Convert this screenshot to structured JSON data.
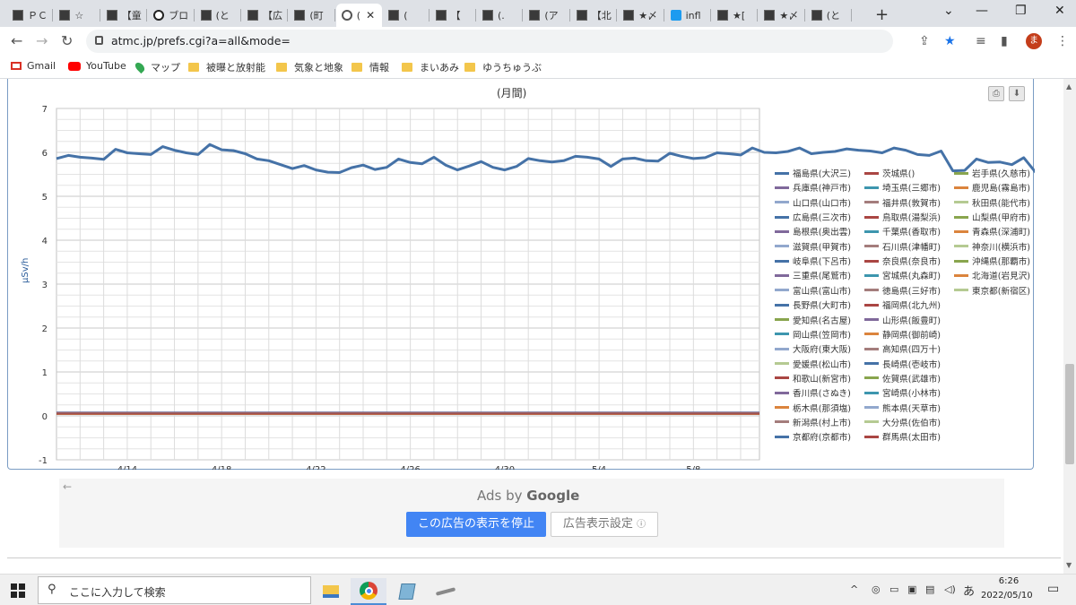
{
  "tabs": [
    {
      "label": "ＰＣ",
      "icon": "site-favicon-icon"
    },
    {
      "label": "☆",
      "icon": "site-favicon-icon"
    },
    {
      "label": "【童",
      "icon": "site-favicon-icon"
    },
    {
      "label": "ブロ",
      "icon": "info-circle-icon"
    },
    {
      "label": "(と",
      "icon": "site-favicon-icon"
    },
    {
      "label": "【広",
      "icon": "site-favicon-icon"
    },
    {
      "label": "(町",
      "icon": "site-favicon-icon"
    },
    {
      "label": "(",
      "icon": "globe-icon",
      "active": true
    },
    {
      "label": "(",
      "icon": "site-favicon-icon"
    },
    {
      "label": "【",
      "icon": "site-favicon-icon"
    },
    {
      "label": "(.",
      "icon": "site-favicon-icon"
    },
    {
      "label": "(ア",
      "icon": "site-favicon-icon"
    },
    {
      "label": "【北",
      "icon": "site-favicon-icon"
    },
    {
      "label": "★〆",
      "icon": "site-favicon-icon"
    },
    {
      "label": "infl",
      "icon": "twitter-icon"
    },
    {
      "label": "★[",
      "icon": "site-favicon-icon"
    },
    {
      "label": "★〆",
      "icon": "site-favicon-icon"
    },
    {
      "label": "(と",
      "icon": "site-favicon-icon"
    }
  ],
  "toolbar": {
    "url": "atmc.jp/prefs.cgi?a=all&mode=",
    "avatar": "ま"
  },
  "bookmarks": [
    {
      "label": "Gmail",
      "icon": "gmail-icon"
    },
    {
      "label": "YouTube",
      "icon": "youtube-icon"
    },
    {
      "label": "マップ",
      "icon": "maps-icon"
    },
    {
      "label": "被曝と放射能",
      "icon": "folder-icon"
    },
    {
      "label": "気象と地象",
      "icon": "folder-icon"
    },
    {
      "label": "情報",
      "icon": "folder-icon"
    },
    {
      "label": "まいあみ",
      "icon": "folder-icon"
    },
    {
      "label": "ゆうちゅうぶ",
      "icon": "folder-icon"
    }
  ],
  "chart_data": {
    "type": "line",
    "title": "(月間)",
    "ylabel": "μSv/h",
    "ylim": [
      -1,
      7
    ],
    "yticks": [
      "7",
      "6",
      "5",
      "4",
      "3",
      "2",
      "1",
      "0",
      "-1"
    ],
    "xticks": [
      "4/14",
      "4/18",
      "4/22",
      "4/26",
      "4/30",
      "5/4",
      "5/8"
    ],
    "x_label_positions_days": [
      3,
      7,
      11,
      15,
      19,
      23,
      27
    ],
    "x_range_days": [
      0,
      29.8
    ],
    "grid": true,
    "legend_position": "right",
    "series": [
      {
        "name": "福島県(大沢三)",
        "color": "#4572a7",
        "x_step_days": 0.5,
        "values": [
          5.86,
          5.93,
          5.89,
          5.87,
          5.84,
          6.07,
          5.99,
          5.97,
          5.95,
          6.13,
          6.05,
          5.99,
          5.95,
          6.18,
          6.06,
          6.04,
          5.97,
          5.85,
          5.81,
          5.72,
          5.63,
          5.7,
          5.6,
          5.55,
          5.54,
          5.65,
          5.71,
          5.61,
          5.66,
          5.85,
          5.77,
          5.74,
          5.89,
          5.71,
          5.6,
          5.69,
          5.79,
          5.66,
          5.6,
          5.68,
          5.86,
          5.81,
          5.78,
          5.81,
          5.91,
          5.89,
          5.85,
          5.68,
          5.85,
          5.87,
          5.81,
          5.8,
          5.98,
          5.91,
          5.86,
          5.88,
          5.99,
          5.97,
          5.94,
          6.1,
          6.0,
          5.99,
          6.02,
          6.1,
          5.97,
          6.0,
          6.02,
          6.08,
          6.05,
          6.03,
          5.99,
          6.1,
          6.05,
          5.95,
          5.93,
          6.03,
          5.58,
          5.59,
          5.85,
          5.77,
          5.78,
          5.72,
          5.88,
          5.55,
          5.63,
          5.71,
          5.84,
          5.77,
          5.66,
          5.64,
          5.82,
          5.88,
          5.72,
          5.69,
          5.86,
          5.96,
          5.99,
          5.92,
          6.04,
          6.0,
          5.91,
          6.11,
          6.08,
          6.04,
          6.05,
          6.11,
          6.07,
          6.05,
          6.12,
          6.22,
          6.14,
          6.03,
          6.05,
          5.93,
          5.82,
          5.8,
          5.77,
          5.76,
          5.79,
          5.8
        ]
      },
      {
        "name": "茨城県()",
        "color": "#aa4643",
        "value": 0.06
      },
      {
        "name": "岩手県(久慈市)",
        "color": "#89a54e",
        "value": 0.05
      },
      {
        "name": "兵庫県(神戸市)",
        "color": "#80699b",
        "value": 0.08
      },
      {
        "name": "埼玉県(三郷市)",
        "color": "#3d96ae",
        "value": 0.05
      },
      {
        "name": "鹿児島(霧島市)",
        "color": "#db843d",
        "value": 0.06
      },
      {
        "name": "山口県(山口市)",
        "color": "#92a8cd",
        "value": 0.07
      },
      {
        "name": "福井県(敦賀市)",
        "color": "#a47d7c",
        "value": 0.06
      },
      {
        "name": "秋田県(能代市)",
        "color": "#b5ca92",
        "value": 0.05
      },
      {
        "name": "広島県(三次市)",
        "color": "#4572a7",
        "value": 0.06
      },
      {
        "name": "鳥取県(湯梨浜)",
        "color": "#aa4643",
        "value": 0.07
      },
      {
        "name": "山梨県(甲府市)",
        "color": "#89a54e",
        "value": 0.05
      },
      {
        "name": "島根県(奥出雲)",
        "color": "#80699b",
        "value": 0.06
      },
      {
        "name": "千葉県(香取市)",
        "color": "#3d96ae",
        "value": 0.05
      },
      {
        "name": "青森県(深浦町)",
        "color": "#db843d",
        "value": 0.04
      },
      {
        "name": "滋賀県(甲賀市)",
        "color": "#92a8cd",
        "value": 0.06
      },
      {
        "name": "石川県(津幡町)",
        "color": "#a47d7c",
        "value": 0.07
      },
      {
        "name": "神奈川(横浜市)",
        "color": "#b5ca92",
        "value": 0.05
      },
      {
        "name": "岐阜県(下呂市)",
        "color": "#4572a7",
        "value": 0.07
      },
      {
        "name": "奈良県(奈良市)",
        "color": "#aa4643",
        "value": 0.06
      },
      {
        "name": "沖縄県(那覇市)",
        "color": "#89a54e",
        "value": 0.05
      },
      {
        "name": "三重県(尾鷲市)",
        "color": "#80699b",
        "value": 0.05
      },
      {
        "name": "宮城県(丸森町)",
        "color": "#3d96ae",
        "value": 0.06
      },
      {
        "name": "北海道(岩見沢)",
        "color": "#db843d",
        "value": 0.04
      },
      {
        "name": "富山県(富山市)",
        "color": "#92a8cd",
        "value": 0.06
      },
      {
        "name": "徳島県(三好市)",
        "color": "#a47d7c",
        "value": 0.05
      },
      {
        "name": "東京都(新宿区)",
        "color": "#b5ca92",
        "value": 0.06
      },
      {
        "name": "長野県(大町市)",
        "color": "#4572a7",
        "value": 0.05
      },
      {
        "name": "福岡県(北九州)",
        "color": "#aa4643",
        "value": 0.05
      },
      {
        "name": "愛知県(名古屋)",
        "color": "#89a54e",
        "value": 0.05
      },
      {
        "name": "山形県(飯豊町)",
        "color": "#80699b",
        "value": 0.06
      },
      {
        "name": "岡山県(笠岡市)",
        "color": "#3d96ae",
        "value": 0.06
      },
      {
        "name": "静岡県(御前崎)",
        "color": "#db843d",
        "value": 0.05
      },
      {
        "name": "大阪府(東大阪)",
        "color": "#92a8cd",
        "value": 0.06
      },
      {
        "name": "高知県(四万十)",
        "color": "#a47d7c",
        "value": 0.05
      },
      {
        "name": "愛媛県(松山市)",
        "color": "#b5ca92",
        "value": 0.06
      },
      {
        "name": "長崎県(壱岐市)",
        "color": "#4572a7",
        "value": 0.06
      },
      {
        "name": "和歌山(新宮市)",
        "color": "#aa4643",
        "value": 0.05
      },
      {
        "name": "佐賀県(武雄市)",
        "color": "#89a54e",
        "value": 0.05
      },
      {
        "name": "香川県(さぬき)",
        "color": "#80699b",
        "value": 0.05
      },
      {
        "name": "宮崎県(小林市)",
        "color": "#3d96ae",
        "value": 0.05
      },
      {
        "name": "栃木県(那須塩)",
        "color": "#db843d",
        "value": 0.06
      },
      {
        "name": "熊本県(天草市)",
        "color": "#92a8cd",
        "value": 0.05
      },
      {
        "name": "新潟県(村上市)",
        "color": "#a47d7c",
        "value": 0.06
      },
      {
        "name": "大分県(佐伯市)",
        "color": "#b5ca92",
        "value": 0.05
      },
      {
        "name": "京都府(京都市)",
        "color": "#4572a7",
        "value": 0.05
      },
      {
        "name": "群馬県(太田市)",
        "color": "#aa4643",
        "value": 0.05
      }
    ]
  },
  "legend_columns": [
    [
      "福島県(大沢三)",
      "兵庫県(神戸市)",
      "山口県(山口市)",
      "広島県(三次市)",
      "島根県(奥出雲)",
      "滋賀県(甲賀市)",
      "岐阜県(下呂市)",
      "三重県(尾鷲市)",
      "富山県(富山市)",
      "長野県(大町市)",
      "愛知県(名古屋)",
      "岡山県(笠岡市)",
      "大阪府(東大阪)",
      "愛媛県(松山市)",
      "和歌山(新宮市)",
      "香川県(さぬき)",
      "栃木県(那須塩)",
      "新潟県(村上市)",
      "京都府(京都市)"
    ],
    [
      "茨城県()",
      "埼玉県(三郷市)",
      "福井県(敦賀市)",
      "鳥取県(湯梨浜)",
      "千葉県(香取市)",
      "石川県(津幡町)",
      "奈良県(奈良市)",
      "宮城県(丸森町)",
      "徳島県(三好市)",
      "福岡県(北九州)",
      "山形県(飯豊町)",
      "静岡県(御前崎)",
      "高知県(四万十)",
      "長崎県(壱岐市)",
      "佐賀県(武雄市)",
      "宮崎県(小林市)",
      "熊本県(天草市)",
      "大分県(佐伯市)",
      "群馬県(太田市)"
    ],
    [
      "岩手県(久慈市)",
      "鹿児島(霧島市)",
      "秋田県(能代市)",
      "山梨県(甲府市)",
      "青森県(深浦町)",
      "神奈川(横浜市)",
      "沖縄県(那覇市)",
      "北海道(岩見沢)",
      "東京都(新宿区)"
    ]
  ],
  "ads": {
    "ads_by": "Ads by",
    "google": "Google",
    "stop_label": "この広告の表示を停止",
    "settings_label": "広告表示設定",
    "back_arrow": "←"
  },
  "taskbar": {
    "search_placeholder": "ここに入力して検索",
    "time": "6:26",
    "date": "2022/05/10",
    "ime": "あ"
  }
}
